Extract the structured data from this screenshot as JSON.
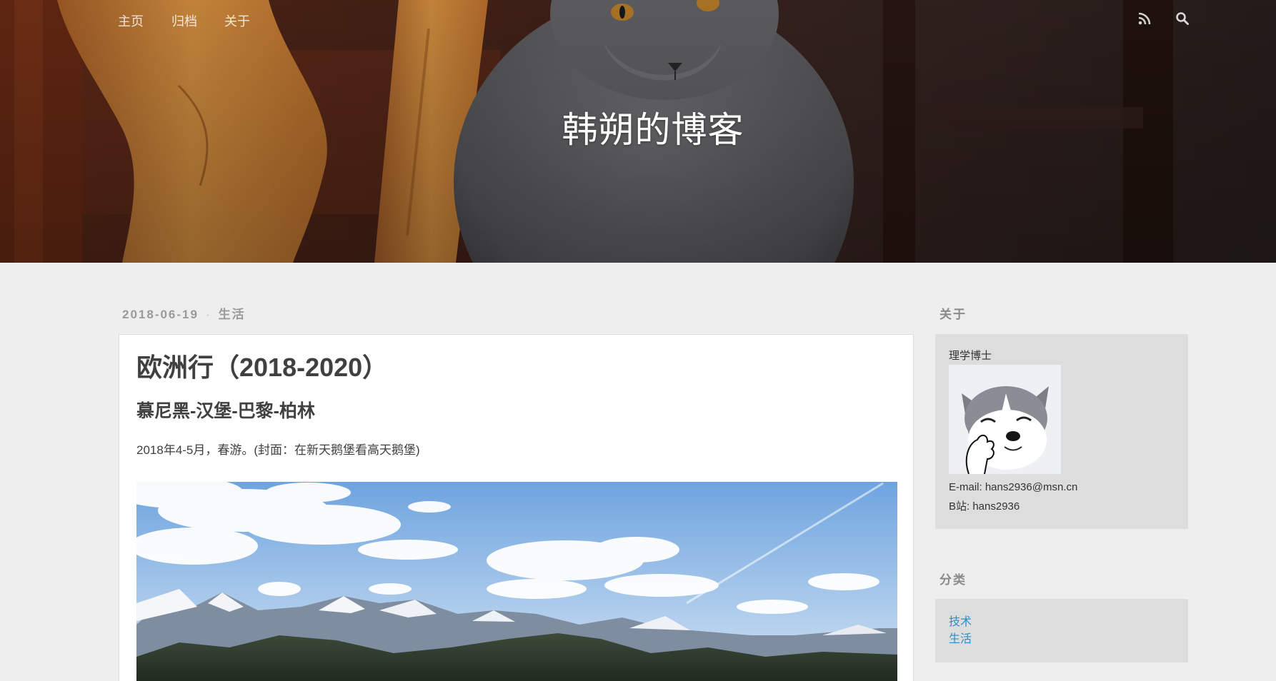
{
  "site": {
    "title": "韩朔的博客"
  },
  "nav": {
    "items": [
      {
        "label": "主页"
      },
      {
        "label": "归档"
      },
      {
        "label": "关于"
      }
    ],
    "icons": [
      "rss-icon",
      "search-icon"
    ]
  },
  "post": {
    "date": "2018-06-19",
    "separator": "·",
    "category": "生活",
    "title": "欧洲行（2018-2020）",
    "subtitle": "慕尼黑-汉堡-巴黎-柏林",
    "intro": "2018年4-5月，春游。(封面：在新天鹅堡看高天鹅堡)"
  },
  "sidebar": {
    "about": {
      "heading": "关于",
      "degree": "理学博士",
      "email": "E-mail: hans2936@msn.cn",
      "bilibili": "B站: hans2936"
    },
    "categories": {
      "heading": "分类",
      "items": [
        {
          "label": "技术"
        },
        {
          "label": "生活"
        }
      ]
    }
  },
  "colors": {
    "page_background": "#eeeeee",
    "card_background": "#ffffff",
    "sidebar_box": "#dddddd",
    "link": "#2a8fc7",
    "text": "#404040",
    "meta": "#9a9a9a"
  }
}
